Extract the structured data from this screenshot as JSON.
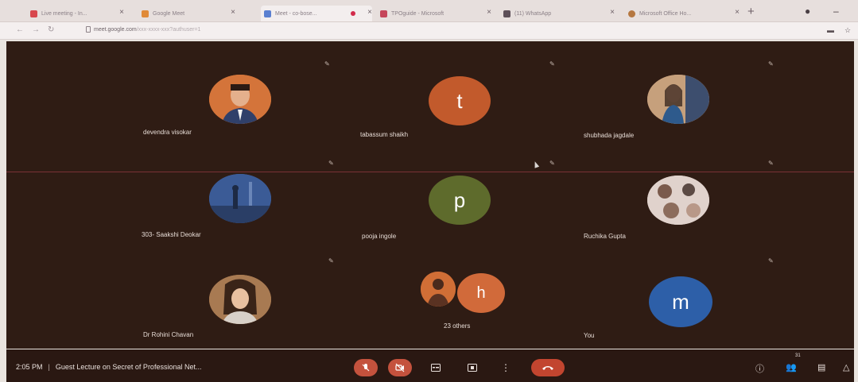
{
  "browser": {
    "tabs": [
      {
        "title": "Live meeting - In...",
        "favicon_color": "#d8484e",
        "active": false
      },
      {
        "title": "Google Meet",
        "favicon_color": "#e08a38",
        "active": false
      },
      {
        "title": "Meet - co-bose...",
        "favicon_color": "#5a7fd0",
        "active": true,
        "recording": true
      },
      {
        "title": "TPOguide - Microsoft",
        "favicon_color": "#c5465a",
        "active": false
      },
      {
        "title": "(11) WhatsApp",
        "favicon_color": "#5d4f58",
        "active": false
      },
      {
        "title": "Microsoft Office Ho...",
        "favicon_color": "#b57740",
        "active": false
      }
    ],
    "new_tab_label": "+",
    "address": {
      "url": "meet.google.com",
      "url_tail": "/xxx-xxxx-xxx?authuser=1"
    }
  },
  "meet": {
    "participants": [
      {
        "name": "devendra visokar",
        "initial": "",
        "avatar": "photo-man",
        "color": "#c87a3c"
      },
      {
        "name": "tabassum shaikh",
        "initial": "t",
        "avatar": "initial",
        "color": "#c25a2c"
      },
      {
        "name": "shubhada jagdale",
        "initial": "",
        "avatar": "photo-woman",
        "color": "#b48a6a"
      },
      {
        "name": "303- Saakshi Deokar",
        "initial": "",
        "avatar": "photo-scene",
        "color": "#3c5d9c"
      },
      {
        "name": "pooja ingole",
        "initial": "p",
        "avatar": "initial",
        "color": "#5e6b2c"
      },
      {
        "name": "Ruchika Gupta",
        "initial": "",
        "avatar": "photo-collage",
        "color": "#d8c8c2"
      },
      {
        "name": "Dr Rohini Chavan",
        "initial": "",
        "avatar": "photo-woman2",
        "color": "#b07a4c"
      },
      {
        "name": "23 others",
        "initial": "h",
        "avatar": "group",
        "color": "#d16a3a"
      },
      {
        "name": "You",
        "initial": "m",
        "avatar": "initial",
        "color": "#2d5fa8"
      }
    ],
    "bottom_bar": {
      "time": "2:05 PM",
      "separator": "|",
      "meeting_title": "Guest Lecture on Secret of Professional Net...",
      "participant_count": "31"
    }
  }
}
